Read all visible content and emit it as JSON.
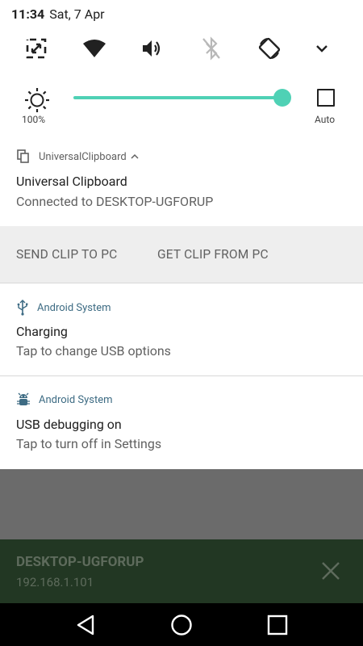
{
  "status_bar": {
    "time": "11:34",
    "date": "Sat, 7 Apr"
  },
  "quick_settings": {
    "tiles": [
      "screen-cast-icon",
      "wifi-icon",
      "volume-icon",
      "bluetooth-off-icon",
      "auto-rotate-icon",
      "chevron-down-icon"
    ],
    "brightness": {
      "label": "100%",
      "level": 1.0
    },
    "auto_label": "Auto",
    "accent_color": "#4fd1b5"
  },
  "notifications": [
    {
      "app": "UniversalClipboard",
      "title": "Universal Clipboard",
      "text": "Connected to DESKTOP-UGFORUP",
      "actions": [
        "SEND CLIP TO PC",
        "GET CLIP FROM PC"
      ]
    },
    {
      "app": "Android System",
      "title": "Charging",
      "text": "Tap to change USB options"
    },
    {
      "app": "Android System",
      "title": "USB debugging on",
      "text": "Tap to turn off in Settings"
    }
  ],
  "system_app_color": "#3d6b83",
  "toast": {
    "title": "DESKTOP-UGFORUP",
    "subtitle": "192.168.1.101"
  },
  "navigation": [
    "back-icon",
    "home-icon",
    "recents-icon"
  ]
}
